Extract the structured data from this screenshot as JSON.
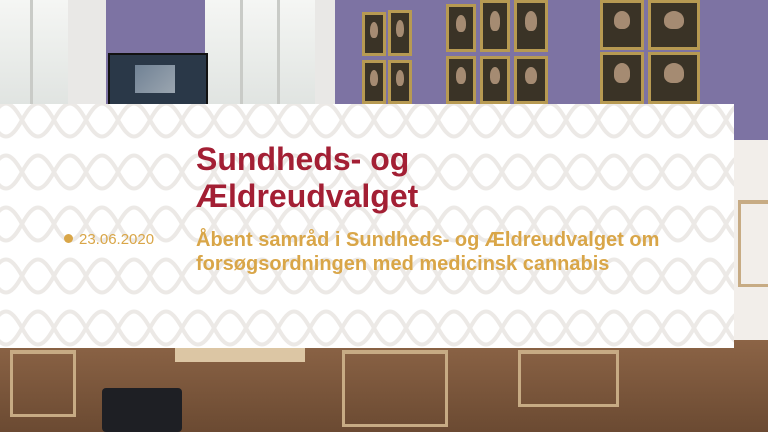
{
  "banner": {
    "title_line1": "Sundheds- og",
    "title_line2": "Ældreudvalget",
    "date": "23.06.2020",
    "subtitle_line1": "Åbent samråd i Sundheds- og Ældreudvalget om",
    "subtitle_line2": "forsøgsordningen med medicinsk cannabis"
  },
  "colors": {
    "title": "#a31f34",
    "accent": "#d9a648",
    "banner_bg": "#ffffff",
    "pattern": "#ece9e6"
  }
}
